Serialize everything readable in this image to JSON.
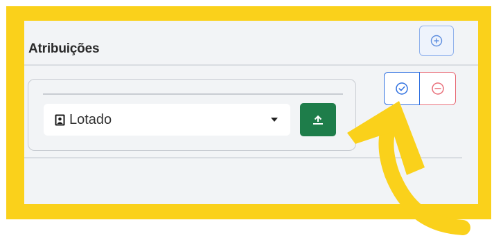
{
  "section": {
    "title": "Atribuições"
  },
  "assignment": {
    "selected_value": "Lotado"
  },
  "icons": {
    "add": "plus-circle-icon",
    "confirm": "check-circle-icon",
    "remove": "minus-circle-icon",
    "select_option": "portrait-icon",
    "upload": "upload-icon",
    "annotation": "curved-arrow-icon"
  },
  "colors": {
    "highlight_frame": "#fad11b",
    "panel_background": "#f2f4f6",
    "add_border": "#8fb1ec",
    "confirm_border": "#2e6fe0",
    "remove_border": "#e86d78",
    "upload_button": "#1e7d4a"
  }
}
